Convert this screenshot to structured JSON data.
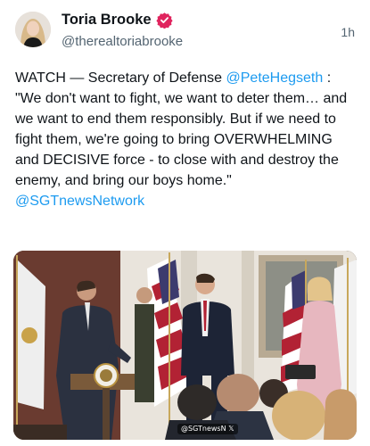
{
  "post": {
    "author": {
      "display_name": "Toria Brooke",
      "handle": "@therealtoriabrooke",
      "avatar_icon": "avatar",
      "verified_icon": "verified-badge-icon",
      "verified_color": "#e0245e"
    },
    "time": "1h",
    "text_parts": {
      "intro": "WATCH — Secretary of Defense ",
      "mention1": "@PeteHegseth",
      "quote": " : \"We don't want to fight, we want to deter them… and we want to end them responsibly. But if we need to fight them, we're going to bring OVERWHELMING and DECISIVE force - to close with and destroy the enemy, and bring our boys home.\" ",
      "mention2": "@SGTnewsNetwork"
    },
    "media": {
      "watermark": "@SGTnewsN 𝕏"
    }
  },
  "colors": {
    "text": "#0f1419",
    "secondary": "#536471",
    "link": "#1d9bf0"
  }
}
